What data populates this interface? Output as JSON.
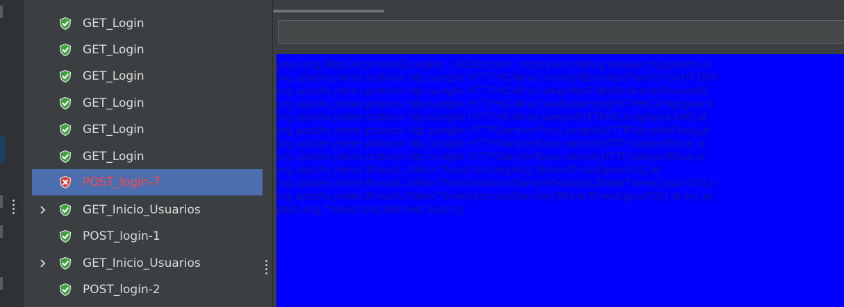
{
  "colors": {
    "background": "#3c3f41",
    "selected_row": "#4b6eaf",
    "success_icon": "#3fa142",
    "error_icon": "#d93b3b",
    "error_text": "#ff4747",
    "response_bg": "#0000ff",
    "response_text": "#1515a8"
  },
  "tree": {
    "items": [
      {
        "label": "GET_Login",
        "status": "success",
        "expandable": false,
        "selected": false
      },
      {
        "label": "GET_Login",
        "status": "success",
        "expandable": false,
        "selected": false
      },
      {
        "label": "GET_Login",
        "status": "success",
        "expandable": false,
        "selected": false
      },
      {
        "label": "GET_Login",
        "status": "success",
        "expandable": false,
        "selected": false
      },
      {
        "label": "GET_Login",
        "status": "success",
        "expandable": false,
        "selected": false
      },
      {
        "label": "GET_Login",
        "status": "success",
        "expandable": false,
        "selected": false
      },
      {
        "label": "POST_login-7",
        "status": "error",
        "expandable": false,
        "selected": true
      },
      {
        "label": "GET_Inicio_Usuarios",
        "status": "success",
        "expandable": true,
        "selected": false
      },
      {
        "label": "POST_login-1",
        "status": "success",
        "expandable": false,
        "selected": false
      },
      {
        "label": "GET_Inicio_Usuarios",
        "status": "success",
        "expandable": true,
        "selected": false
      },
      {
        "label": "POST_login-2",
        "status": "success",
        "expandable": false,
        "selected": false
      }
    ]
  },
  "response": {
    "url_value": "",
    "lines": [
      "java.lang.IllegalArgumentException: URLDecoder: Incomplete trailing escape (%) pattern at",
      "org.apache.jmeter.protocol.http.sampler.HTTPHC4Impl.createUrlEncodedFormEntity(HTTPH",
      "org.apache.jmeter.protocol.http.sampler.HTTPHC4Impl.setupHttpEntityEnclosingRequestD",
      "org.apache.jmeter.protocol.http.sampler.HTTPHC4Impl.handleMethod(HTTPHC4Impl.java:6",
      "org.apache.jmeter.protocol.http.sampler.HTTPHC4Impl.sample(HTTPHC4Impl.java:646) at",
      "org.apache.jmeter.protocol.http.sampler.HTTPSamplerProxy.sample(HTTPSamplerProxy.ja",
      "org.apache.jmeter.protocol.http.sampler.HTTPSamplerBase.sample(HTTPSamplerBase.ja",
      "org.apache.jmeter.protocol.http.sampler.HTTPSamplerBase.sample(HTTPSamplerBase.ja",
      "org.apache.jmeter.threads.JMeterThread.doSampling(JMeterThread.java:651) at",
      "org.apache.jmeter.threads.JMeterThread.executeSamplePackage(JMeterThread.java:570) a",
      "org.apache.jmeter.threads.JMeterThread.processSampler(JMeterThread.java:501) at org.ap",
      "java.lang.Thread.run(Unknown Source)"
    ]
  }
}
